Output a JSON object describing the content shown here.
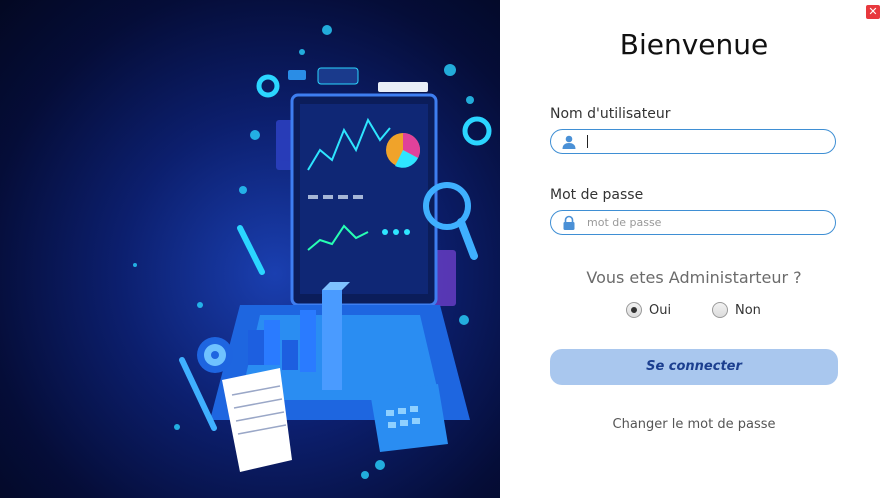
{
  "window": {
    "close_glyph": "✕"
  },
  "illustration": {
    "icon": "dashboard-laptop-illustration"
  },
  "login": {
    "title": "Bienvenue",
    "username": {
      "label": "Nom d'utilisateur",
      "value": "",
      "placeholder": "",
      "icon": "user-icon"
    },
    "password": {
      "label": "Mot de passe",
      "value": "",
      "placeholder": "mot de passe",
      "icon": "lock-icon"
    },
    "admin_question": "Vous etes Administarteur ?",
    "admin_options": [
      {
        "label": "Oui",
        "selected": true
      },
      {
        "label": "Non",
        "selected": false
      }
    ],
    "submit_label": "Se connecter",
    "change_password_link": "Changer le mot de passe"
  },
  "colors": {
    "accent": "#3f8fd4",
    "button_bg": "#a9c7ee",
    "button_text": "#1c3f8f",
    "close_bg": "#e8383d"
  }
}
